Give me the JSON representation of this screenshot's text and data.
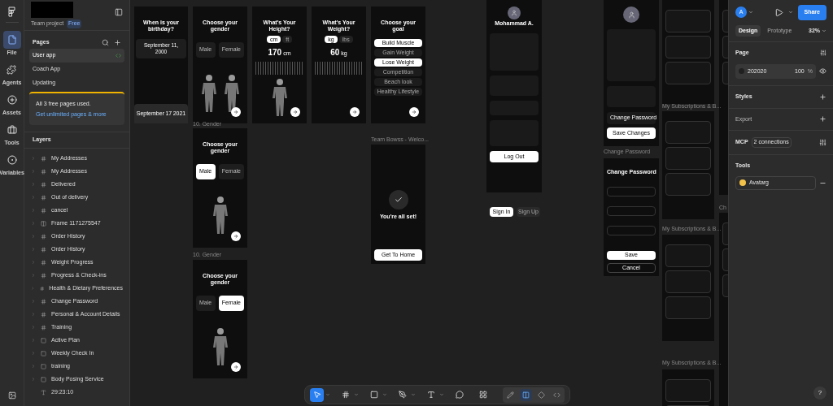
{
  "file": {
    "team": "Team project",
    "plan": "Free"
  },
  "rail": [
    {
      "label": "File",
      "selected": true
    },
    {
      "label": "Agents",
      "selected": false
    },
    {
      "label": "Assets",
      "selected": false
    },
    {
      "label": "Tools",
      "selected": false
    },
    {
      "label": "Variables",
      "selected": false
    }
  ],
  "pages": {
    "title": "Pages",
    "items": [
      {
        "name": "User app",
        "selected": true
      },
      {
        "name": "Coach App",
        "selected": false
      },
      {
        "name": "Updating",
        "selected": false
      }
    ]
  },
  "upgrade": {
    "text": "All 3 free pages used.",
    "link": "Get unlimited pages & more"
  },
  "layers": {
    "title": "Layers",
    "items": [
      {
        "name": "My Addresses",
        "kind": "frame"
      },
      {
        "name": "My Addresses",
        "kind": "frame"
      },
      {
        "name": "Delivered",
        "kind": "frame"
      },
      {
        "name": "Out of delivery",
        "kind": "frame"
      },
      {
        "name": "cancel",
        "kind": "frame"
      },
      {
        "name": "Frame 1171275547",
        "kind": "autolayout"
      },
      {
        "name": "Order History",
        "kind": "frame"
      },
      {
        "name": "Order History",
        "kind": "frame"
      },
      {
        "name": "Weight Progress",
        "kind": "frame"
      },
      {
        "name": "Progress & Check-ins",
        "kind": "frame"
      },
      {
        "name": "Health & Dietary Preferences",
        "kind": "frame"
      },
      {
        "name": "Change Password",
        "kind": "frame"
      },
      {
        "name": "Personal & Account Details",
        "kind": "frame"
      },
      {
        "name": "Training",
        "kind": "frame"
      },
      {
        "name": "Active Plan",
        "kind": "section"
      },
      {
        "name": "Weekly Check In",
        "kind": "section"
      },
      {
        "name": "training",
        "kind": "section"
      },
      {
        "name": "Body Posing Service",
        "kind": "section"
      },
      {
        "name": "29:23:10",
        "kind": "text"
      }
    ]
  },
  "canvas": {
    "labels": [
      {
        "text": "10. Gender"
      },
      {
        "text": "10. Gender"
      },
      {
        "text": "Team Bowss - Welco..."
      },
      {
        "text": "Change Password"
      },
      {
        "text": "My Subscriptions & B..."
      },
      {
        "text": "My Subscriptions & B..."
      },
      {
        "text": "My Subscriptions & B..."
      },
      {
        "text": "Ch"
      }
    ],
    "frames": [
      {
        "kind": "birthday",
        "title": "When is your birthday?",
        "value": "September 11, 2000",
        "picker": [
          "September",
          "17",
          "2021"
        ]
      },
      {
        "kind": "gender",
        "title": "Choose your gender",
        "options": [
          {
            "label": "Male",
            "selected": false
          },
          {
            "label": "Female",
            "selected": false
          }
        ]
      },
      {
        "kind": "height",
        "title": "What's Your Height?",
        "units": [
          {
            "label": "cm",
            "selected": true
          },
          {
            "label": "ft",
            "selected": false
          }
        ],
        "reading": "170",
        "unit": "cm"
      },
      {
        "kind": "weight",
        "title": "What's Your Weight?",
        "units": [
          {
            "label": "kg",
            "selected": true
          },
          {
            "label": "lbs",
            "selected": false
          }
        ],
        "reading": "60",
        "unit": "kg"
      },
      {
        "kind": "goal",
        "title": "Choose your goal",
        "options": [
          {
            "label": "Build Muscle",
            "selected": true
          },
          {
            "label": "Gain Weight",
            "selected": false
          },
          {
            "label": "Lose Weight",
            "selected": true
          },
          {
            "label": "Competition",
            "selected": false
          },
          {
            "label": "Beach look",
            "selected": false
          },
          {
            "label": "Healthy Lifestyle",
            "selected": false
          }
        ]
      },
      {
        "kind": "gender",
        "title": "Choose your gender",
        "options": [
          {
            "label": "Male",
            "selected": true
          },
          {
            "label": "Female",
            "selected": false
          }
        ]
      },
      {
        "kind": "gender",
        "title": "Choose your gender",
        "options": [
          {
            "label": "Male",
            "selected": false
          },
          {
            "label": "Female",
            "selected": true
          }
        ]
      },
      {
        "kind": "welcome",
        "title": "You're all set!",
        "button": "Get To Home"
      },
      {
        "kind": "profile",
        "name": "Mohammad A.",
        "button": "Log Out"
      },
      {
        "kind": "auth",
        "options": [
          {
            "label": "Sign In",
            "selected": true
          },
          {
            "label": "Sign Up",
            "selected": false
          }
        ]
      },
      {
        "kind": "edit",
        "button": "Save Changes",
        "row": "Change Password"
      },
      {
        "kind": "password",
        "title": "Change Password",
        "save": "Save",
        "cancel": "Cancel"
      },
      {
        "kind": "cards"
      },
      {
        "kind": "cards"
      },
      {
        "kind": "cards"
      },
      {
        "kind": "cards"
      },
      {
        "kind": "cards"
      },
      {
        "kind": "cards"
      }
    ]
  },
  "toolbar": [
    {
      "selected": true
    },
    {
      "selected": false
    },
    {
      "selected": false
    },
    {
      "selected": false
    },
    {
      "selected": false
    },
    {
      "selected": false
    },
    {
      "selected": false
    }
  ],
  "modes": [
    {
      "selected": false
    },
    {
      "selected": true
    },
    {
      "selected": false
    },
    {
      "selected": false
    }
  ],
  "right": {
    "avatar": "A",
    "share": "Share",
    "tabs": [
      {
        "label": "Design",
        "selected": true
      },
      {
        "label": "Prototype",
        "selected": false
      }
    ],
    "zoom": "32%",
    "page": {
      "title": "Page",
      "color": "#202020",
      "hex": "202020",
      "opacity": "100",
      "unit": "%"
    },
    "styles": "Styles",
    "export": "Export",
    "mcp": {
      "title": "MCP",
      "badge": "2 connections"
    },
    "tools": {
      "title": "Tools",
      "item": "Avatarg"
    }
  },
  "help": "?"
}
